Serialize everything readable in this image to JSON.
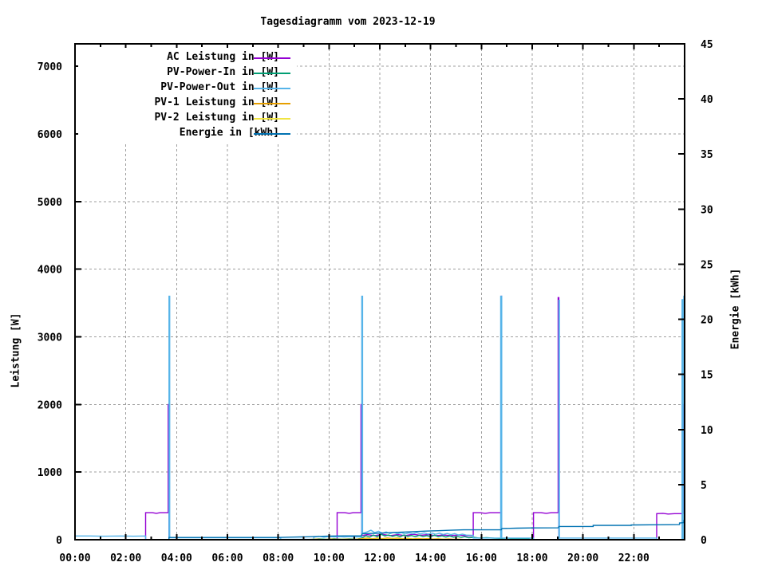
{
  "chart_data": {
    "type": "line",
    "title": "Tagesdiagramm vom 2023-12-19",
    "x_axis": {
      "min": 0,
      "max": 24,
      "minor_tick_hours": 1,
      "major_tick_hours": 2,
      "tick_labels": [
        {
          "hour": 0,
          "label": "00:00"
        },
        {
          "hour": 2,
          "label": "02:00"
        },
        {
          "hour": 4,
          "label": "04:00"
        },
        {
          "hour": 6,
          "label": "06:00"
        },
        {
          "hour": 8,
          "label": "08:00"
        },
        {
          "hour": 10,
          "label": "10:00"
        },
        {
          "hour": 12,
          "label": "12:00"
        },
        {
          "hour": 14,
          "label": "14:00"
        },
        {
          "hour": 16,
          "label": "16:00"
        },
        {
          "hour": 18,
          "label": "18:00"
        },
        {
          "hour": 20,
          "label": "20:00"
        },
        {
          "hour": 22,
          "label": "22:00"
        }
      ]
    },
    "y_left_axis": {
      "label": "Leistung [W]",
      "min": 0,
      "max": 7333,
      "ticks": [
        0,
        1000,
        2000,
        3000,
        4000,
        5000,
        6000,
        7000
      ],
      "grid": true
    },
    "y_right_axis": {
      "label": "Energie [kWh]",
      "min": 0,
      "max": 45,
      "ticks": [
        0,
        5,
        10,
        15,
        20,
        25,
        30,
        35,
        40,
        45
      ]
    },
    "grid": {
      "style": "dashed",
      "color": "#9e9e9e"
    },
    "legend_position": "top-left",
    "series": [
      {
        "id": "ac-leistung",
        "name": "AC Leistung in [W]",
        "color": "#9400d3",
        "axis": "left",
        "points": [
          [
            0,
            0
          ],
          [
            2.78,
            0
          ],
          [
            2.78,
            400
          ],
          [
            3.05,
            400
          ],
          [
            3.2,
            390
          ],
          [
            3.35,
            400
          ],
          [
            3.67,
            400
          ],
          [
            3.67,
            2000
          ],
          [
            3.7,
            2000
          ],
          [
            3.7,
            0
          ],
          [
            10.32,
            0
          ],
          [
            10.32,
            400
          ],
          [
            10.62,
            400
          ],
          [
            10.8,
            390
          ],
          [
            10.95,
            400
          ],
          [
            11.26,
            400
          ],
          [
            11.26,
            2000
          ],
          [
            11.29,
            2000
          ],
          [
            11.29,
            60
          ],
          [
            11.5,
            75
          ],
          [
            11.8,
            60
          ],
          [
            12.1,
            80
          ],
          [
            12.4,
            60
          ],
          [
            12.7,
            75
          ],
          [
            13.0,
            60
          ],
          [
            13.3,
            80
          ],
          [
            13.6,
            65
          ],
          [
            13.9,
            75
          ],
          [
            14.2,
            60
          ],
          [
            14.5,
            70
          ],
          [
            14.8,
            60
          ],
          [
            15.1,
            70
          ],
          [
            15.4,
            60
          ],
          [
            15.68,
            60
          ],
          [
            15.68,
            400
          ],
          [
            15.95,
            400
          ],
          [
            16.15,
            390
          ],
          [
            16.35,
            400
          ],
          [
            16.78,
            400
          ],
          [
            16.78,
            3600
          ],
          [
            16.8,
            3600
          ],
          [
            16.8,
            0
          ],
          [
            18.05,
            0
          ],
          [
            18.05,
            400
          ],
          [
            18.35,
            400
          ],
          [
            18.55,
            390
          ],
          [
            18.75,
            400
          ],
          [
            19.02,
            400
          ],
          [
            19.02,
            3580
          ],
          [
            19.05,
            3580
          ],
          [
            19.05,
            0
          ],
          [
            22.9,
            0
          ],
          [
            22.9,
            385
          ],
          [
            23.15,
            390
          ],
          [
            23.35,
            380
          ],
          [
            23.6,
            385
          ],
          [
            23.95,
            385
          ],
          [
            23.95,
            2000
          ],
          [
            23.99,
            2000
          ],
          [
            23.99,
            0
          ]
        ]
      },
      {
        "id": "pv-power-in",
        "name": "PV-Power-In in [W]",
        "color": "#009e73",
        "axis": "left",
        "points": [
          [
            9.3,
            3
          ],
          [
            9.6,
            12
          ],
          [
            9.9,
            6
          ],
          [
            10.2,
            14
          ],
          [
            10.5,
            8
          ],
          [
            10.8,
            12
          ],
          [
            11.1,
            8
          ],
          [
            11.3,
            25
          ],
          [
            11.45,
            60
          ],
          [
            11.6,
            40
          ],
          [
            11.75,
            70
          ],
          [
            11.9,
            45
          ],
          [
            12.05,
            80
          ],
          [
            12.2,
            55
          ],
          [
            12.35,
            70
          ],
          [
            12.5,
            50
          ],
          [
            12.65,
            65
          ],
          [
            12.8,
            45
          ],
          [
            12.95,
            70
          ],
          [
            13.1,
            50
          ],
          [
            13.25,
            62
          ],
          [
            13.4,
            45
          ],
          [
            13.55,
            65
          ],
          [
            13.7,
            48
          ],
          [
            13.85,
            60
          ],
          [
            14.0,
            45
          ],
          [
            14.15,
            68
          ],
          [
            14.3,
            45
          ],
          [
            14.45,
            58
          ],
          [
            14.6,
            40
          ],
          [
            14.75,
            55
          ],
          [
            14.9,
            38
          ],
          [
            15.05,
            50
          ],
          [
            15.2,
            35
          ],
          [
            15.35,
            45
          ],
          [
            15.5,
            30
          ],
          [
            15.7,
            35
          ],
          [
            15.9,
            25
          ],
          [
            16.2,
            30
          ],
          [
            16.5,
            22
          ],
          [
            16.78,
            20
          ],
          [
            17.0,
            25
          ],
          [
            17.3,
            15
          ],
          [
            17.6,
            18
          ],
          [
            17.9,
            8
          ],
          [
            18.0,
            0
          ]
        ]
      },
      {
        "id": "pv-power-out",
        "name": "PV-Power-Out in [W]",
        "color": "#56b4e9",
        "axis": "left",
        "points": [
          [
            0,
            55
          ],
          [
            0.6,
            55
          ],
          [
            1.2,
            52
          ],
          [
            1.8,
            55
          ],
          [
            2.3,
            52
          ],
          [
            2.78,
            55
          ],
          [
            2.78,
            0
          ],
          [
            3.7,
            0
          ],
          [
            3.7,
            3600
          ],
          [
            3.73,
            3600
          ],
          [
            3.73,
            30
          ],
          [
            4.5,
            30
          ],
          [
            5.5,
            28
          ],
          [
            6.5,
            30
          ],
          [
            7.5,
            28
          ],
          [
            8.1,
            30
          ],
          [
            8.1,
            6
          ],
          [
            9.4,
            6
          ],
          [
            9.4,
            38
          ],
          [
            9.6,
            52
          ],
          [
            9.8,
            38
          ],
          [
            10.0,
            48
          ],
          [
            10.2,
            40
          ],
          [
            10.4,
            46
          ],
          [
            10.6,
            40
          ],
          [
            10.8,
            46
          ],
          [
            11.0,
            40
          ],
          [
            11.26,
            44
          ],
          [
            11.29,
            44
          ],
          [
            11.29,
            3600
          ],
          [
            11.32,
            3600
          ],
          [
            11.32,
            95
          ],
          [
            11.5,
            115
          ],
          [
            11.65,
            140
          ],
          [
            11.8,
            105
          ],
          [
            11.95,
            125
          ],
          [
            12.1,
            95
          ],
          [
            12.25,
            115
          ],
          [
            12.4,
            90
          ],
          [
            12.55,
            110
          ],
          [
            12.7,
            88
          ],
          [
            12.85,
            105
          ],
          [
            13.0,
            85
          ],
          [
            13.15,
            100
          ],
          [
            13.3,
            88
          ],
          [
            13.45,
            105
          ],
          [
            13.6,
            85
          ],
          [
            13.75,
            100
          ],
          [
            13.9,
            82
          ],
          [
            14.05,
            98
          ],
          [
            14.2,
            80
          ],
          [
            14.35,
            95
          ],
          [
            14.5,
            78
          ],
          [
            14.65,
            92
          ],
          [
            14.8,
            75
          ],
          [
            14.95,
            90
          ],
          [
            15.1,
            70
          ],
          [
            15.25,
            82
          ],
          [
            15.4,
            68
          ],
          [
            15.68,
            65
          ],
          [
            15.68,
            25
          ],
          [
            16.2,
            25
          ],
          [
            16.76,
            25
          ],
          [
            16.76,
            3600
          ],
          [
            16.8,
            3600
          ],
          [
            16.8,
            25
          ],
          [
            17.3,
            25
          ],
          [
            17.8,
            25
          ],
          [
            18.05,
            25
          ],
          [
            18.05,
            0
          ],
          [
            19.02,
            0
          ],
          [
            19.05,
            0
          ],
          [
            19.05,
            3540
          ],
          [
            19.07,
            3540
          ],
          [
            19.07,
            25
          ],
          [
            20.0,
            25
          ],
          [
            21.0,
            25
          ],
          [
            22.0,
            25
          ],
          [
            22.9,
            25
          ],
          [
            22.9,
            0
          ],
          [
            23.9,
            0
          ],
          [
            23.9,
            3550
          ],
          [
            23.92,
            3550
          ],
          [
            23.92,
            20
          ],
          [
            23.97,
            20
          ],
          [
            23.97,
            3600
          ],
          [
            24,
            3600
          ]
        ]
      },
      {
        "id": "pv-1-leistung",
        "name": "PV-1 Leistung in [W]",
        "color": "#e69f00",
        "axis": "left",
        "points": [
          [
            9.2,
            3
          ],
          [
            9.5,
            8
          ],
          [
            9.8,
            4
          ],
          [
            10.1,
            9
          ],
          [
            10.4,
            5
          ],
          [
            10.7,
            8
          ],
          [
            11.0,
            5
          ],
          [
            11.3,
            15
          ],
          [
            11.5,
            24
          ],
          [
            11.7,
            14
          ],
          [
            11.9,
            22
          ],
          [
            12.1,
            15
          ],
          [
            12.3,
            26
          ],
          [
            12.5,
            16
          ],
          [
            12.7,
            23
          ],
          [
            12.9,
            14
          ],
          [
            13.1,
            20
          ],
          [
            13.3,
            13
          ],
          [
            13.5,
            19
          ],
          [
            13.7,
            12
          ],
          [
            13.9,
            17
          ],
          [
            14.1,
            10
          ],
          [
            14.3,
            14
          ],
          [
            14.5,
            8
          ],
          [
            14.7,
            11
          ],
          [
            14.9,
            6
          ],
          [
            15.1,
            8
          ],
          [
            15.3,
            4
          ],
          [
            15.4,
            2
          ],
          [
            15.4,
            0
          ]
        ]
      },
      {
        "id": "pv-2-leistung",
        "name": "PV-2 Leistung in [W]",
        "color": "#f0e442",
        "axis": "left",
        "points": [
          [
            9.2,
            2
          ],
          [
            9.6,
            5
          ],
          [
            10.0,
            2
          ],
          [
            10.4,
            5
          ],
          [
            10.8,
            3
          ],
          [
            11.2,
            4
          ],
          [
            11.5,
            11
          ],
          [
            11.7,
            7
          ],
          [
            11.9,
            12
          ],
          [
            12.1,
            7
          ],
          [
            12.3,
            13
          ],
          [
            12.5,
            8
          ],
          [
            12.7,
            11
          ],
          [
            12.9,
            6
          ],
          [
            13.1,
            10
          ],
          [
            13.3,
            6
          ],
          [
            13.5,
            9
          ],
          [
            13.7,
            5
          ],
          [
            13.9,
            8
          ],
          [
            14.1,
            4
          ],
          [
            14.4,
            6
          ],
          [
            14.7,
            3
          ],
          [
            15.0,
            4
          ],
          [
            15.4,
            2
          ],
          [
            15.8,
            2
          ],
          [
            16.0,
            0
          ]
        ]
      },
      {
        "id": "energie",
        "name": "Energie in [kWh]",
        "color": "#0072b2",
        "axis": "right",
        "points": [
          [
            1.4,
            0
          ],
          [
            3.7,
            0
          ],
          [
            3.7,
            0.2
          ],
          [
            8.0,
            0.2
          ],
          [
            8.6,
            0.24
          ],
          [
            9.4,
            0.28
          ],
          [
            10.0,
            0.33
          ],
          [
            10.6,
            0.35
          ],
          [
            11.26,
            0.35
          ],
          [
            11.32,
            0.55
          ],
          [
            11.8,
            0.58
          ],
          [
            12.3,
            0.63
          ],
          [
            12.8,
            0.68
          ],
          [
            13.3,
            0.73
          ],
          [
            13.8,
            0.78
          ],
          [
            14.3,
            0.82
          ],
          [
            14.8,
            0.86
          ],
          [
            15.3,
            0.9
          ],
          [
            15.9,
            0.9
          ],
          [
            16.78,
            0.9
          ],
          [
            16.81,
            1.02
          ],
          [
            17.4,
            1.05
          ],
          [
            18.0,
            1.07
          ],
          [
            19.02,
            1.08
          ],
          [
            19.05,
            1.2
          ],
          [
            20.4,
            1.2
          ],
          [
            20.4,
            1.3
          ],
          [
            21.9,
            1.3
          ],
          [
            21.9,
            1.34
          ],
          [
            23.0,
            1.36
          ],
          [
            23.8,
            1.38
          ],
          [
            23.8,
            1.52
          ],
          [
            23.97,
            1.55
          ],
          [
            23.97,
            1.75
          ],
          [
            24,
            1.8
          ]
        ]
      }
    ]
  }
}
